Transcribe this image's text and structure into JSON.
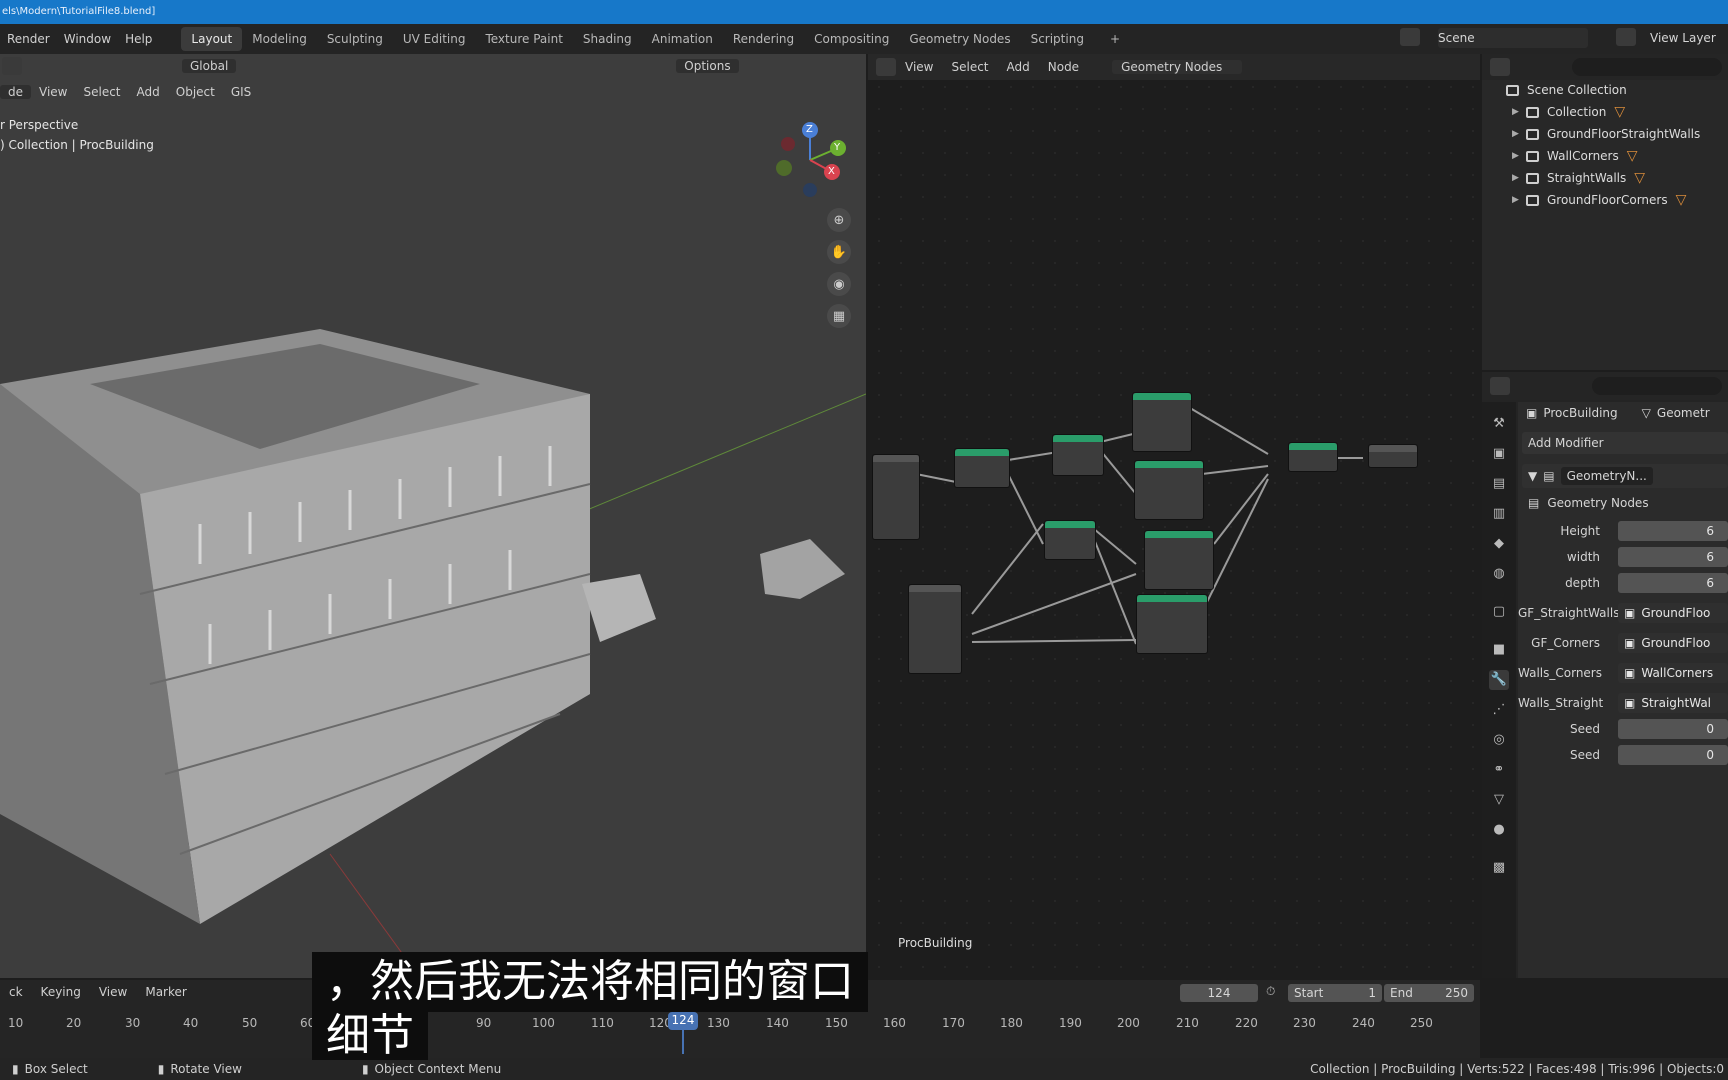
{
  "window": {
    "title": "els\\Modern\\TutorialFile8.blend]"
  },
  "topbar": {
    "menus": [
      "Render",
      "Window",
      "Help"
    ],
    "workspaces": [
      "Layout",
      "Modeling",
      "Sculpting",
      "UV Editing",
      "Texture Paint",
      "Shading",
      "Animation",
      "Rendering",
      "Compositing",
      "Geometry Nodes",
      "Scripting"
    ],
    "active_workspace": "Layout",
    "scene": "Scene",
    "view_layer": "View Layer"
  },
  "viewport": {
    "transform_orientation": "Global",
    "options_label": "Options",
    "mode": "de",
    "menus": [
      "View",
      "Select",
      "Add",
      "Object",
      "GIS"
    ],
    "overlay_line1": "r Perspective",
    "overlay_line2": ") Collection | ProcBuilding",
    "axis_x": "X",
    "axis_y": "Y",
    "axis_z": "Z"
  },
  "node_editor": {
    "menus": [
      "View",
      "Select",
      "Add",
      "Node"
    ],
    "tree_name": "Geometry Nodes",
    "footer_label": "ProcBuilding"
  },
  "outliner": {
    "root": "Scene Collection",
    "items": [
      {
        "label": "Collection"
      },
      {
        "label": "GroundFloorStraightWalls"
      },
      {
        "label": "WallCorners"
      },
      {
        "label": "StraightWalls"
      },
      {
        "label": "GroundFloorCorners"
      }
    ]
  },
  "properties": {
    "object": "ProcBuilding",
    "data_tab": "Geometr",
    "add_modifier": "Add Modifier",
    "modifier_name": "GeometryN...",
    "node_group": "Geometry Nodes",
    "fields": [
      {
        "label": "Height",
        "value": "6",
        "kind": "num"
      },
      {
        "label": "width",
        "value": "6",
        "kind": "num"
      },
      {
        "label": "depth",
        "value": "6",
        "kind": "num"
      },
      {
        "label": "GF_StraightWalls",
        "value": "GroundFloo",
        "kind": "obj"
      },
      {
        "label": "GF_Corners",
        "value": "GroundFloo",
        "kind": "obj"
      },
      {
        "label": "Walls_Corners",
        "value": "WallCorners",
        "kind": "obj"
      },
      {
        "label": "Walls_Straight",
        "value": "StraightWal",
        "kind": "obj"
      },
      {
        "label": "Seed",
        "value": "0",
        "kind": "num"
      },
      {
        "label": "Seed",
        "value": "0",
        "kind": "num"
      }
    ]
  },
  "timeline": {
    "menus": [
      "ck",
      "Keying",
      "View",
      "Marker"
    ],
    "current_frame": "124",
    "start_label": "Start",
    "start": "1",
    "end_label": "End",
    "end": "250",
    "ticks": [
      "10",
      "20",
      "30",
      "40",
      "50",
      "60",
      "90",
      "100",
      "110",
      "120",
      "130",
      "140",
      "150",
      "160",
      "170",
      "180",
      "190",
      "200",
      "210",
      "220",
      "230",
      "240",
      "250"
    ]
  },
  "statusbar": {
    "left1": "Box Select",
    "left2": "Rotate View",
    "left3": "Object Context Menu",
    "right": "Collection | ProcBuilding | Verts:522 | Faces:498 | Tris:996 | Objects:0"
  },
  "subtitle": {
    "line1": "，然后我无法将相同的窗口",
    "line2": "细节"
  }
}
